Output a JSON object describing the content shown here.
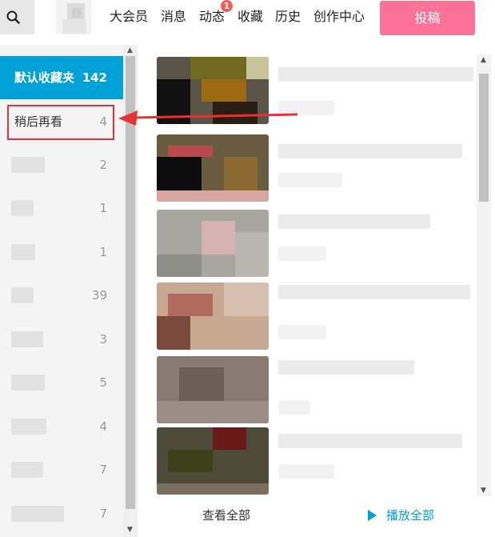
{
  "header": {
    "nav": [
      {
        "label": "大会员"
      },
      {
        "label": "消息"
      },
      {
        "label": "动态"
      },
      {
        "label": "收藏"
      },
      {
        "label": "历史"
      },
      {
        "label": "创作中心"
      }
    ],
    "dynamic_badge": "1",
    "post_button": "投稿",
    "icons": {
      "search": "search-icon",
      "avatar": "avatar"
    },
    "accent_color": "#fb7299"
  },
  "favorites": {
    "active_color": "#00a1d6",
    "items": [
      {
        "name": "默认收藏夹",
        "count": "142"
      },
      {
        "name": "稍后再看",
        "count": "4"
      },
      {
        "name": "",
        "count": "2"
      },
      {
        "name": "",
        "count": "1"
      },
      {
        "name": "",
        "count": "1"
      },
      {
        "name": "",
        "count": "39"
      },
      {
        "name": "",
        "count": "3"
      },
      {
        "name": "",
        "count": "5"
      },
      {
        "name": "",
        "count": "4"
      },
      {
        "name": "",
        "count": "7"
      },
      {
        "name": "",
        "count": "7"
      }
    ]
  },
  "footer": {
    "view_all": "查看全部",
    "play_all": "播放全部"
  },
  "annotation": {
    "highlight_color": "#e53333"
  }
}
